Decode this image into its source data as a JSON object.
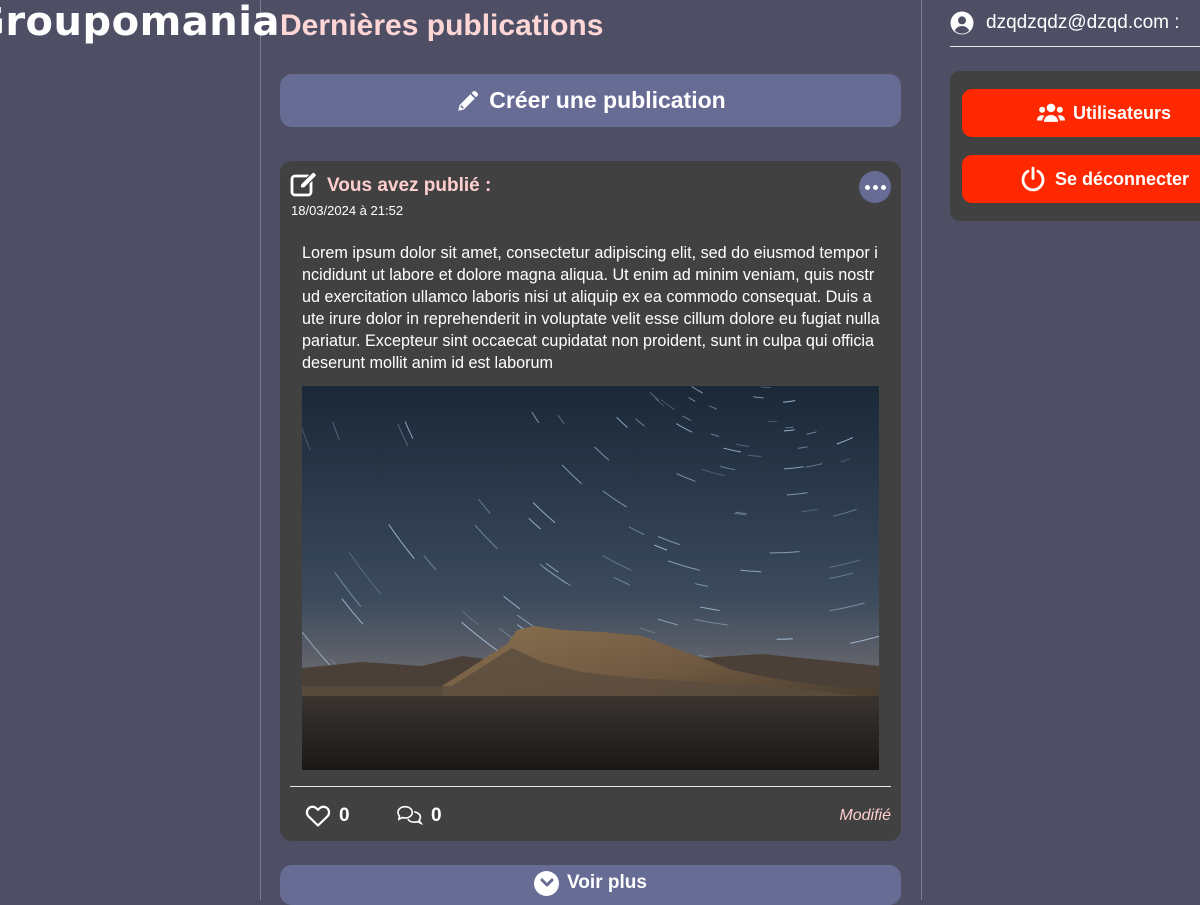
{
  "brand": {
    "logo_text": "Groupomania"
  },
  "main": {
    "title": "Dernières publications",
    "create_label": "Créer une publication",
    "see_more_label": "Voir plus"
  },
  "post": {
    "header_label": "Vous avez publié :",
    "date": "18/03/2024 à 21:52",
    "text": "Lorem ipsum dolor sit amet, consectetur adipiscing elit, sed do eiusmod tempor incididunt ut labore et dolore magna aliqua. Ut enim ad minim veniam, quis nostrud exercitation ullamco laboris nisi ut aliquip ex ea commodo consequat. Duis aute irure dolor in reprehenderit in voluptate velit esse cillum dolore eu fugiat nulla pariatur. Excepteur sint occaecat cupidatat non proident, sunt in culpa qui officia deserunt mollit anim id est laborum",
    "image_subject": "star-trails-over-desert-mesa",
    "likes": "0",
    "comments": "0",
    "edited_label": "Modifié"
  },
  "user": {
    "email_label": "dzqdzqdz@dzqd.com :"
  },
  "menu": {
    "users_label": "Utilisateurs",
    "logout_label": "Se déconnecter"
  },
  "icons": {
    "create": "pencil-icon",
    "post_header": "edit-square-icon",
    "more": "ellipsis-icon",
    "like": "heart-icon",
    "comment": "comments-icon",
    "see_more": "chevron-down-icon",
    "user": "user-circle-icon",
    "users": "users-icon",
    "logout": "power-icon"
  },
  "colors": {
    "background": "#4e4e65",
    "card": "#414141",
    "primary_button": "#666c94",
    "accent_text": "#ffd6d6",
    "danger": "#ff2800"
  }
}
